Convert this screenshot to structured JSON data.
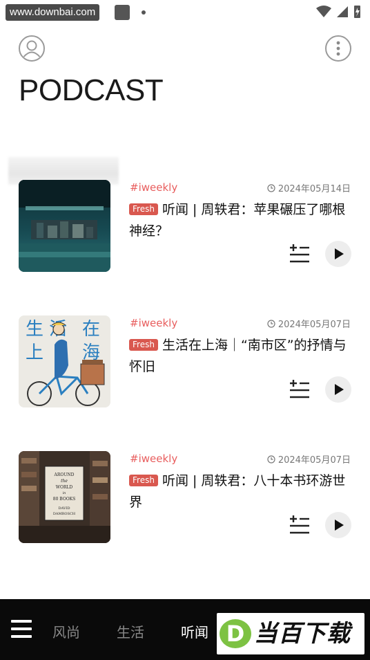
{
  "status_bar": {
    "url": "www.downbai.com"
  },
  "header": {
    "title": "PODCAST"
  },
  "episodes": [
    {
      "tag": "#iweekly",
      "date": "2024年05月14日",
      "badge": "Fresh",
      "title": "听闻 | 周轶君：苹果碾压了哪根神经？"
    },
    {
      "tag": "#iweekly",
      "date": "2024年05月07日",
      "badge": "Fresh",
      "title": "生活在上海｜“南市区”的抒情与怀旧",
      "cover_text": [
        "生",
        "活",
        "在",
        "上",
        "海"
      ]
    },
    {
      "tag": "#iweekly",
      "date": "2024年05月07日",
      "badge": "Fresh",
      "title": "听闻 | 周轶君：八十本书环游世界",
      "cover_text": [
        "AROUND",
        "the",
        "WORLD",
        "in",
        "80 BOOKS",
        "DAVID",
        "DAMROSCH"
      ]
    }
  ],
  "nav": {
    "tabs": [
      "风尚",
      "生活",
      "听闻"
    ],
    "active": "听闻"
  },
  "logo": {
    "mark": "D",
    "text": "当百下载"
  },
  "colors": {
    "tag": "#e85d5d",
    "badge": "#d9584f",
    "nav_bg": "#0a0a0a",
    "logo_green": "#7dc243"
  }
}
